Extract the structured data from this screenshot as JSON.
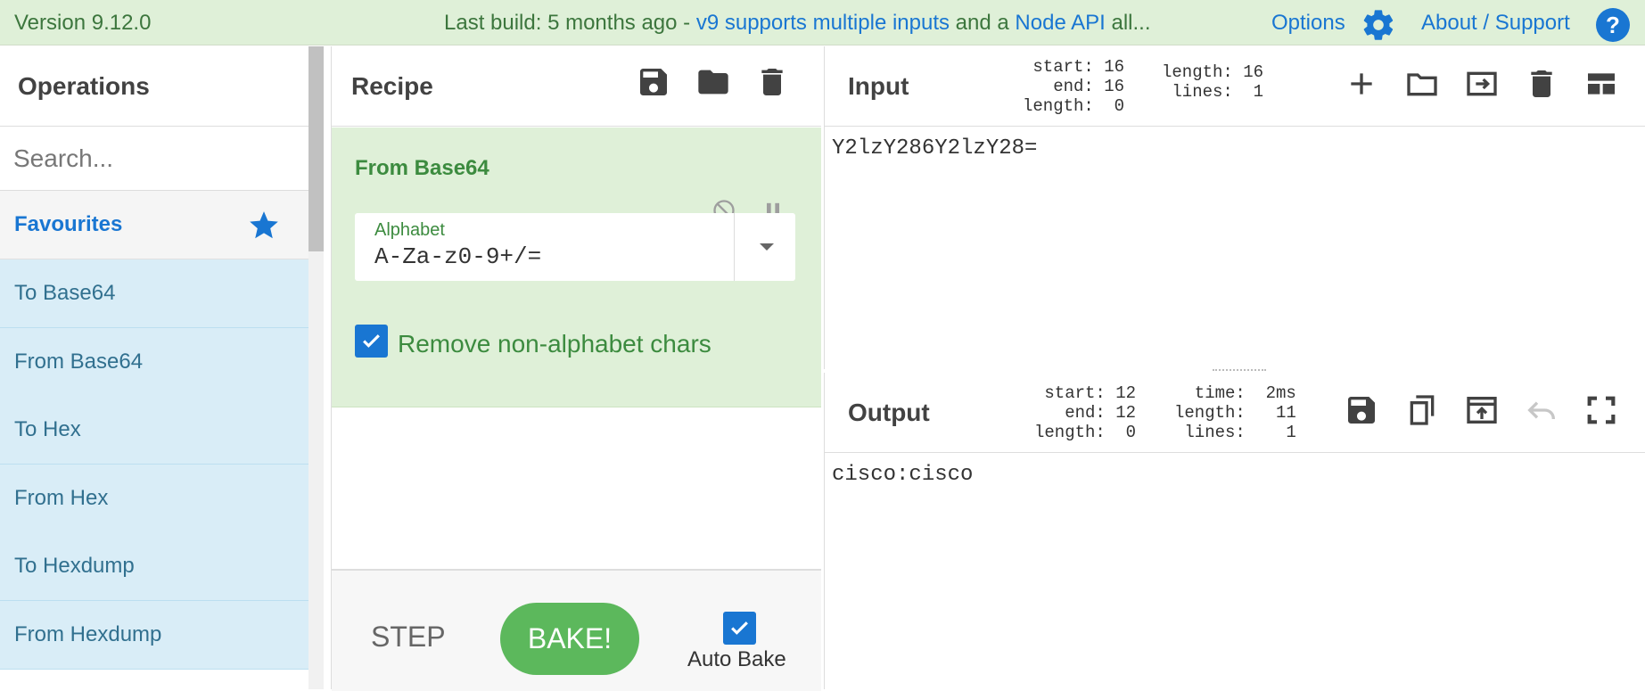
{
  "banner": {
    "version": "Version 9.12.0",
    "notice_prefix": "Last build: 5 months ago - ",
    "notice_link1": "v9 supports",
    "notice_mid": " ",
    "notice_link2": "multiple inputs",
    "notice_mid2": " and a ",
    "notice_link3": "Node API",
    "notice_suffix": " all...",
    "options": "Options",
    "about": "About / Support",
    "help_glyph": "?"
  },
  "operations": {
    "title": "Operations",
    "search_placeholder": "Search...",
    "favourites": "Favourites",
    "items": [
      "To Base64",
      "From Base64",
      "To Hex",
      "From Hex",
      "To Hexdump",
      "From Hexdump"
    ]
  },
  "recipe": {
    "title": "Recipe",
    "operation": {
      "name": "From Base64",
      "alphabet_label": "Alphabet",
      "alphabet_value": "A-Za-z0-9+/=",
      "remove_label": "Remove non-alphabet chars",
      "remove_checked": true
    },
    "step": "STEP",
    "bake": "BAKE!",
    "auto_bake": "Auto Bake",
    "auto_bake_checked": true
  },
  "input": {
    "title": "Input",
    "stats_left": "start: 16\n  end: 16\nlength:  0",
    "stats_right": "length: 16\n lines:  1",
    "text": "Y2lzY286Y2lzY28="
  },
  "output": {
    "title": "Output",
    "stats_left": "start: 12\n  end: 12\nlength:  0",
    "stats_right": "time:  2ms\nlength:   11\n lines:    1",
    "text": "cisco:cisco"
  },
  "colors": {
    "accent": "#1976d2",
    "banner_bg": "#dff0d8",
    "banner_text": "#3c763d",
    "op_bg": "#d9edf7",
    "op_text": "#31708f",
    "bake": "#5cb85c"
  }
}
